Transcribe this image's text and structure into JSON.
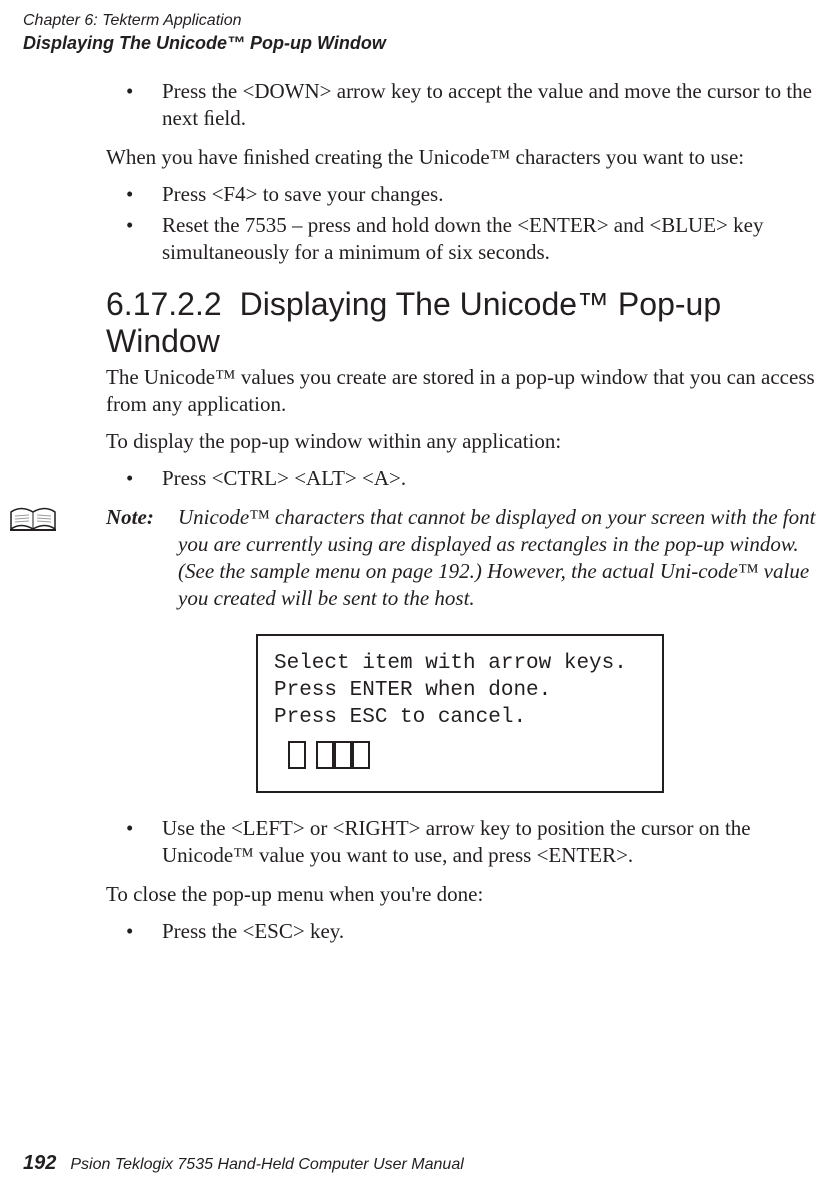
{
  "header": {
    "chapter_line": "Chapter 6: Tekterm Application",
    "section_line": "Displaying The Unicode™ Pop-up Window"
  },
  "body": {
    "b1_li1": "Press the <DOWN> arrow key to accept the value and move the cursor to the next ﬁeld.",
    "p1": "When you have ﬁnished creating the Unicode™ characters you want to use:",
    "b2_li1": "Press <F4> to save your changes.",
    "b2_li2": "Reset the 7535 – press and hold down the <ENTER> and <BLUE> key simultaneously for a minimum of six seconds.",
    "heading_num": "6.17.2.2",
    "heading_text": "Displaying The Unicode™ Pop-up Window",
    "p2": "The Unicode™ values you create are stored in a pop-up window that you can access from any application.",
    "p3": "To display the pop-up window within any application:",
    "b3_li1": "Press <CTRL> <ALT> <A>.",
    "note_label": "Note:",
    "note_text": "Unicode™ characters that cannot be displayed on your screen with the font you are currently using are displayed as rectangles in the pop-up window. (See the sample menu on page 192.) However, the actual Uni-code™ value you created will be sent to the host.",
    "sample_line1": "Select item with arrow keys.",
    "sample_line2": "Press ENTER when done.",
    "sample_line3": "Press ESC to cancel.",
    "b4_li1": "Use the <LEFT> or <RIGHT> arrow key to position the cursor on the Unicode™ value you want to use, and press <ENTER>.",
    "p4": "To close the pop-up menu when you're done:",
    "b5_li1": "Press the <ESC> key."
  },
  "footer": {
    "page_number": "192",
    "manual_title": "Psion Teklogix 7535 Hand-Held Computer User Manual"
  }
}
